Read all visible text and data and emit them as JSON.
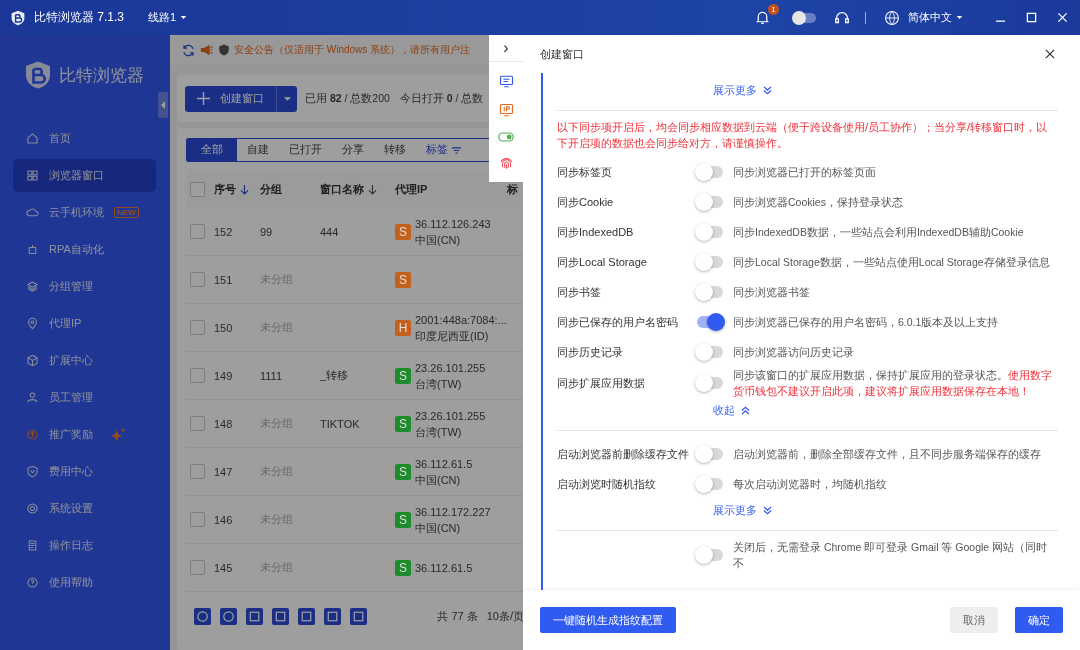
{
  "title_bar": {
    "app_title": "比特浏览器 7.1.3",
    "route": "线路1",
    "notification_count": "1",
    "language": "简体中文"
  },
  "sidebar": {
    "logo_text": "比特浏览器",
    "items": [
      {
        "label": "首页",
        "selected": false
      },
      {
        "label": "浏览器窗口",
        "selected": true
      },
      {
        "label": "云手机环境",
        "selected": false,
        "badge": "NEW"
      },
      {
        "label": "RPA自动化",
        "selected": false
      },
      {
        "label": "分组管理",
        "selected": false
      },
      {
        "label": "代理IP",
        "selected": false
      },
      {
        "label": "扩展中心",
        "selected": false
      },
      {
        "label": "员工管理",
        "selected": false
      },
      {
        "label": "推广奖励",
        "selected": false,
        "sparkle": true
      },
      {
        "label": "费用中心",
        "selected": false
      },
      {
        "label": "系统设置",
        "selected": false
      },
      {
        "label": "操作日志",
        "selected": false
      },
      {
        "label": "使用帮助",
        "selected": false
      }
    ]
  },
  "notice": {
    "text": "安全公告（仅适用于 Windows 系统），请所有用户注"
  },
  "toolbar": {
    "create_button": "创建窗口",
    "used": "已用 **82** / 总数200",
    "opened_today": "今日打开 **0** / 总数"
  },
  "tabs": [
    {
      "label": "全部",
      "selected": true
    },
    {
      "label": "自建",
      "selected": false
    },
    {
      "label": "已打开",
      "selected": false
    },
    {
      "label": "分享",
      "selected": false
    },
    {
      "label": "转移",
      "selected": false
    },
    {
      "label": "标签",
      "selected": false
    }
  ],
  "table": {
    "select_all_checked": false,
    "columns": [
      "序号",
      "分组",
      "窗口名称",
      "代理IP",
      "标"
    ],
    "rows": [
      {
        "checked": false,
        "seq": "152",
        "group": "99",
        "muted": false,
        "name": "444",
        "proxy": "S",
        "color": "#c4611e",
        "ip": "36.112.126.243",
        "region": "中国(CN)"
      },
      {
        "checked": false,
        "seq": "151",
        "group": "未分组",
        "muted": true,
        "proxy": "S",
        "color": "#c4611e"
      },
      {
        "checked": false,
        "seq": "150",
        "group": "未分组",
        "muted": true,
        "proxy": "H",
        "color": "#c4611e",
        "ip": "2001:448a:7084:...",
        "region": "印度尼西亚(ID)"
      },
      {
        "checked": false,
        "seq": "149",
        "group": "1111",
        "muted": false,
        "name": "_转移",
        "proxy": "S",
        "color": "#1e8c2a",
        "ip": "23.26.101.255",
        "region": "台湾(TW)"
      },
      {
        "checked": false,
        "seq": "148",
        "group": "未分组",
        "muted": true,
        "name": "TIKTOK",
        "proxy": "S",
        "color": "#1e8c2a",
        "ip": "23.26.101.255",
        "region": "台湾(TW)"
      },
      {
        "checked": false,
        "seq": "147",
        "group": "未分组",
        "muted": true,
        "proxy": "S",
        "color": "#1e8c2a",
        "ip": "36.112.61.5",
        "region": "中国(CN)"
      },
      {
        "checked": false,
        "seq": "146",
        "group": "未分组",
        "muted": true,
        "proxy": "S",
        "color": "#1e8c2a",
        "ip": "36.112.172.227",
        "region": "中国(CN)"
      },
      {
        "checked": false,
        "seq": "145",
        "group": "未分组",
        "muted": true,
        "proxy": "S",
        "color": "#1e8c2a",
        "ip": "36.112.61.5"
      }
    ],
    "total": "共 77 条",
    "page_size": "10条/页"
  },
  "mini_toolbar": {
    "collapse": "›"
  },
  "modal": {
    "title": "创建窗口",
    "show_more_top": "展示更多",
    "warning": "以下同步项开启后，均会同步相应数据到云端（便于跨设备使用/员工协作）；当分享/转移窗口时，以下开启项的数据也会同步给对方，请谨慎操作。",
    "sync_settings": [
      {
        "label": "同步标签页",
        "on": false,
        "desc": "同步浏览器已打开的标签页面"
      },
      {
        "label": "同步Cookie",
        "on": false,
        "desc": "同步浏览器Cookies，保持登录状态"
      },
      {
        "label": "同步IndexedDB",
        "on": false,
        "desc": "同步IndexedDB数据，一些站点会利用IndexedDB辅助Cookie"
      },
      {
        "label": "同步Local Storage",
        "on": false,
        "desc": "同步Local Storage数据，一些站点使用Local Storage存储登录信息"
      },
      {
        "label": "同步书签",
        "on": false,
        "desc": "同步浏览器书签"
      },
      {
        "label": "同步已保存的用户名密码",
        "on": true,
        "desc": "同步浏览器已保存的用户名密码，6.0.1版本及以上支持"
      },
      {
        "label": "同步历史记录",
        "on": false,
        "desc": "同步浏览器访问历史记录"
      },
      {
        "label": "同步扩展应用数据",
        "on": false,
        "desc": "同步该窗口的扩展应用数据，保持扩展应用的登录状态。",
        "warning": "使用数字货币钱包不建议开启此项，建议将扩展应用数据保存在本地！"
      }
    ],
    "collapse": "收起",
    "startup_settings": [
      {
        "label": "启动浏览器前删除缓存文件",
        "on": false,
        "desc": "启动浏览器前，删除全部缓存文件，且不同步服务端保存的缓存"
      },
      {
        "label": "启动浏览时随机指纹",
        "on": false,
        "desc": "每次启动浏览器时，均随机指纹"
      }
    ],
    "show_more_bottom": "展示更多",
    "next_setting": {
      "on": false,
      "desc": "关闭后，无需登录 Chrome 即可登录 Gmail 等 Google 网站（同时不"
    },
    "random_button": "一键随机生成指纹配置",
    "cancel": "取消",
    "confirm": "确定"
  }
}
